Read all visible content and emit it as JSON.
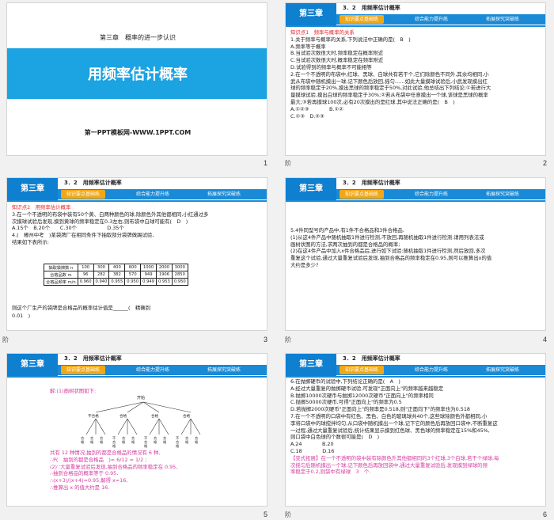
{
  "slides": [
    {
      "num": "1",
      "cover_sub": "第三章　概率的进一步认识",
      "cover_title": "用频率估计概率",
      "cover_foot": "第一PPT模板网-WWW.1PPT.COM"
    },
    {
      "num": "2",
      "corner": "阶",
      "chapter": "第三章",
      "section": "3．2　用频率估计概率",
      "tabs": [
        "知识要点基础练",
        "综合能力提升练",
        "拓展探究突破练"
      ],
      "page": "-2-",
      "lines": [
        {
          "t": "知识点1　频率与概率的关系",
          "c": "red"
        },
        {
          "t": "1.关于频率与概率的关系,下列说法中正确的是(　B　)"
        },
        {
          "t": "A.频率等于概率"
        },
        {
          "t": "B.当试验次数很大时,频率稳定在概率附近"
        },
        {
          "t": "C.当试验次数很大时,概率稳定在频率附近"
        },
        {
          "t": "D.试验得到的频率与概率不可能相等"
        },
        {
          "t": "2.在一个不透明的布袋中,红球、黑球、白球共有若干个,它们除颜色不同外,其余均相同,小"
        },
        {
          "t": "武从布袋中随机摸出一球,记下颜色后放回,摇匀……如此大量摸球试验后,小武发现摸出红"
        },
        {
          "t": "球的频率稳定于20%,摸出黑球的频率稳定于50%,对此试验,他总结出下列结论:①若进行大"
        },
        {
          "t": "量摸球试验,摸出白球的频率稳定于30%;②若从布袋中任意摸出一个球,该球是黑球的概率"
        },
        {
          "t": "最大;③若再摸球100次,必有20次摸出的是红球.其中说法正确的是(　B　)"
        },
        {
          "t": "A.①②③　　　　B.①②"
        },
        {
          "t": "C.①③　D.②③"
        }
      ]
    },
    {
      "num": "3",
      "corner": "阶",
      "chapter": "第三章",
      "section": "3．2　用频率估计概率",
      "tabs": [
        "知识要点基础练",
        "综合能力提升练",
        "拓展探究突破练"
      ],
      "page": "-3-",
      "lines": [
        {
          "t": "知识点2　用频率估计概率",
          "c": "red"
        },
        {
          "t": "3.在一个不透明的布袋中装有50个黄、白两种颜色的球,除颜色外其他都相同,小红通过多"
        },
        {
          "t": "次摸球试验后发现,摸到黄球的频率稳定在0.3左右,则布袋中白球可能有(　D　)"
        },
        {
          "t": "A.15个　B.20个　　C.30个　　　　　　D.35个"
        },
        {
          "t": "4.(　郴州中考　)某袋牌厂在相同条件下抽取部分袋牌做踢试验,"
        },
        {
          "t": "结果如下表所示:"
        }
      ],
      "table": {
        "rows": [
          [
            "抽取袋牌数 n",
            "100",
            "300",
            "400",
            "600",
            "1000",
            "2000",
            "3000"
          ],
          [
            "合格品数 m",
            "96",
            "282",
            "382",
            "570",
            "949",
            "1906",
            "2850"
          ],
          [
            "合格品频率 m/n",
            "0.960",
            "0.940",
            "0.955",
            "0.950",
            "0.949",
            "0.953",
            "0.950"
          ]
        ]
      },
      "tail": "则这个厂生产的袋牌是合格品的概率估计值是______(　精确到",
      "tail2": "0.01　)"
    },
    {
      "num": "4",
      "corner": "阶",
      "chapter": "第三章",
      "section": "3．2　用频率估计概率",
      "tabs": [
        "知识要点基础练",
        "综合能力提升练",
        "拓展探究突破练"
      ],
      "page": "-4-",
      "lines": [
        {
          "t": "5.4件同型号的产品中,有1件不合格品和3件合格品."
        },
        {
          "t": "(1)从这4件产品中随机抽取1件进行检测,不放回,再随机抽取1件进行检测.请用列表法或"
        },
        {
          "t": "画树状图的方法,求两次抽到的都是合格品的概率;"
        },
        {
          "t": "(2)在这4件产品中加入x件合格品后,进行如下试验:随机抽取1件进行检测,然后放回,多次"
        },
        {
          "t": "重复这个试验,通过大量重复试验后发现,抽到合格品的频率稳定在0.95,则可以推算出x的值"
        },
        {
          "t": "大约是多少?"
        }
      ]
    },
    {
      "num": "5",
      "chapter": "第三章",
      "section": "3．2　用频率估计概率",
      "tabs": [
        "知识要点基础练",
        "综合能力提升练",
        "拓展探究突破练"
      ],
      "page": "-5-",
      "sol_title": "解:(1)画树状图如下:",
      "tree_root": "开始",
      "tree_l1": [
        "不合格",
        "合格",
        "合格",
        "合格"
      ],
      "tree_l2": [
        "合格",
        "合格",
        "合格",
        "不合格",
        "合格",
        "合格",
        "不合格",
        "合格",
        "合格",
        "不合格",
        "合格",
        "合格"
      ],
      "lines": [
        {
          "t": "共有 12 种情况,抽到的都是合格品的情况有 6 种,"
        },
        {
          "t": "∴P(　抽到的都是合格品　)= 6/12 = 1/2 ;"
        },
        {
          "t": "(2)∵大量重复试验后发现,抽到合格品的频率稳定在 0.95,"
        },
        {
          "t": "∴抽到合格品的概率等于 0.95,"
        },
        {
          "t": "∴(x+3)/(x+4)=0.95,解得 x=16,"
        },
        {
          "t": "∴推算出 x 的值大约是 16."
        }
      ]
    },
    {
      "num": "6",
      "corner": "阶",
      "chapter": "第三章",
      "section": "3．2　用频率估计概率",
      "tabs": [
        "知识要点基础练",
        "综合能力提升练",
        "拓展探究突破练"
      ],
      "page": "-6-",
      "lines": [
        {
          "t": "6.在抛掷硬币的试验中,下列结论正确的是(　A　)"
        },
        {
          "t": "A.经过大量重复的抛掷硬币试验,可发现\"正面向上\"的频率越来越稳定"
        },
        {
          "t": "B.抛掷10000次硬币与抛掷12000次硬币\"正面向上\"的频率相同"
        },
        {
          "t": "C.抛掷50000次硬币,可得\"正面向上\"的频率为0.5"
        },
        {
          "t": "D.若抛掷2000次硬币\"正面向上\"的频率是0.518,则\"正面向下\"的频率也为0.518"
        },
        {
          "t": "7.在一个不透明的口袋中有红色、黑色、白色的玻璃球共40个,这些球除颜色外都相同,小"
        },
        {
          "t": "李将口袋中的球搅拌均匀,从口袋中随机摸出一个球,记下它的颜色后再放回口袋中,不断重复这"
        },
        {
          "t": "一过程,通过大量重复试验后,统计结果显示摸到红色球、黑色球的频率稳定在15%和45%,"
        },
        {
          "t": "则口袋中白色球的个数很可能是(　D　)"
        },
        {
          "t": "A.24　　　　B.20"
        },
        {
          "t": "C.18　　　　D.16"
        },
        {
          "t": "【变式拓展】在一个不透明的袋中装有除颜色外其他都相同的3个红球,3个白球,若干个绿球,每",
          "c": "pink"
        },
        {
          "t": "次摇匀后随机摸出一个球,记下颜色后再放回袋中,通过大量重复试验后,发现摸到绿球的频",
          "c": "pink"
        },
        {
          "t": "率稳定于0.2,则袋中有绿球　3　个.",
          "c": "pink"
        }
      ]
    }
  ]
}
